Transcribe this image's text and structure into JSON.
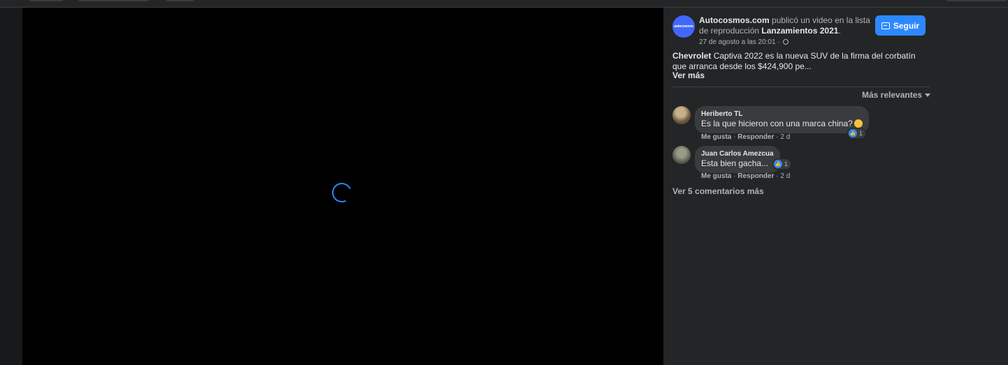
{
  "post": {
    "page_name": "Autocosmos.com",
    "action_text": "publicó un video en la lista de reproducción",
    "playlist": "Lanzamientos 2021",
    "date": "27 de agosto a las 20:01 ·",
    "avatar_text": "autocosmos",
    "follow_label": "Seguir",
    "description_brand": "Chevrolet",
    "description_rest": "Captiva 2022 es la nueva SUV de la firma del corbatín que arranca desde los $424,900 pe...",
    "see_more": "Ver más"
  },
  "sort": {
    "label": "Más relevantes"
  },
  "comments": [
    {
      "author": "Heriberto TL",
      "text": "Es la que hicieron con una marca china?",
      "reactions": "1",
      "like": "Me gusta",
      "reply": "Responder",
      "time": "2 d"
    },
    {
      "author": "Juan Carlos Amezcua",
      "text": "Esta bien gacha...",
      "reactions": "1",
      "like": "Me gusta",
      "reply": "Responder",
      "time": "2 d"
    }
  ],
  "more_comments": "Ver 5 comentarios más",
  "colors": {
    "accent": "#2d88ff",
    "panel": "#242526",
    "bubble": "#3a3b3c"
  }
}
